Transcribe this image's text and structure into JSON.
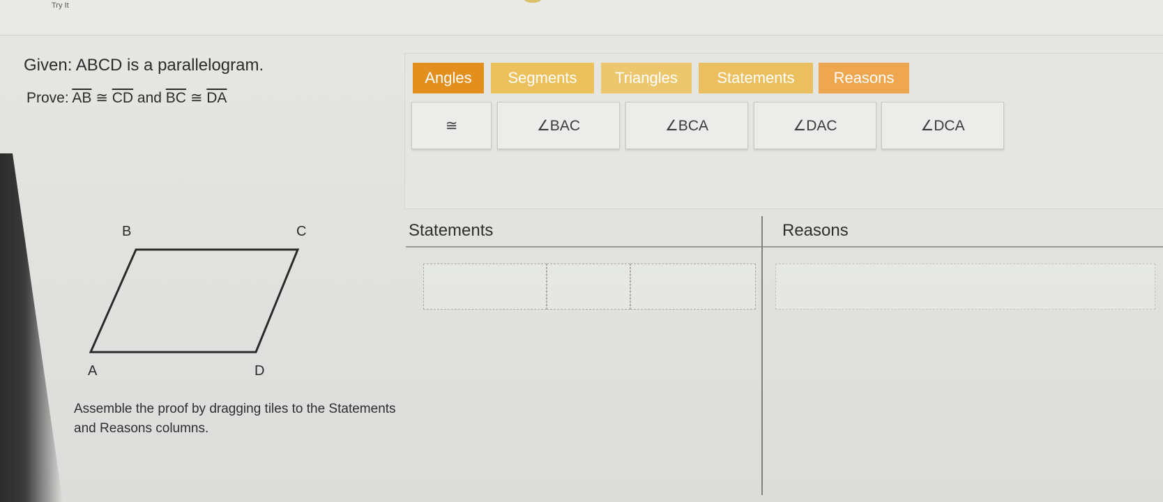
{
  "window": {
    "title": "Try It"
  },
  "problem": {
    "given": "Given: ABCD is a parallelogram.",
    "prove_prefix": "Prove:",
    "prove_seg1": "AB",
    "prove_cong1": "≅",
    "prove_seg2": "CD",
    "prove_and": "and",
    "prove_seg3": "BC",
    "prove_cong2": "≅",
    "prove_seg4": "DA"
  },
  "tabs": [
    {
      "label": "Angles",
      "color": "#e38f1d",
      "active": true
    },
    {
      "label": "Segments",
      "color": "#ecc05a"
    },
    {
      "label": "Triangles",
      "color": "#ecc76d"
    },
    {
      "label": "Statements",
      "color": "#ebbf5e"
    },
    {
      "label": "Reasons",
      "color": "#efa74f"
    }
  ],
  "tiles": [
    {
      "label": "≅"
    },
    {
      "label": "∠BAC"
    },
    {
      "label": "∠BCA"
    },
    {
      "label": "∠DAC"
    },
    {
      "label": "∠DCA"
    }
  ],
  "figure": {
    "label_b": "B",
    "label_c": "C",
    "label_a": "A",
    "label_d": "D"
  },
  "instructions": "Assemble the proof by dragging tiles to the Statements and Reasons columns.",
  "proof_table": {
    "statements_header": "Statements",
    "reasons_header": "Reasons"
  }
}
